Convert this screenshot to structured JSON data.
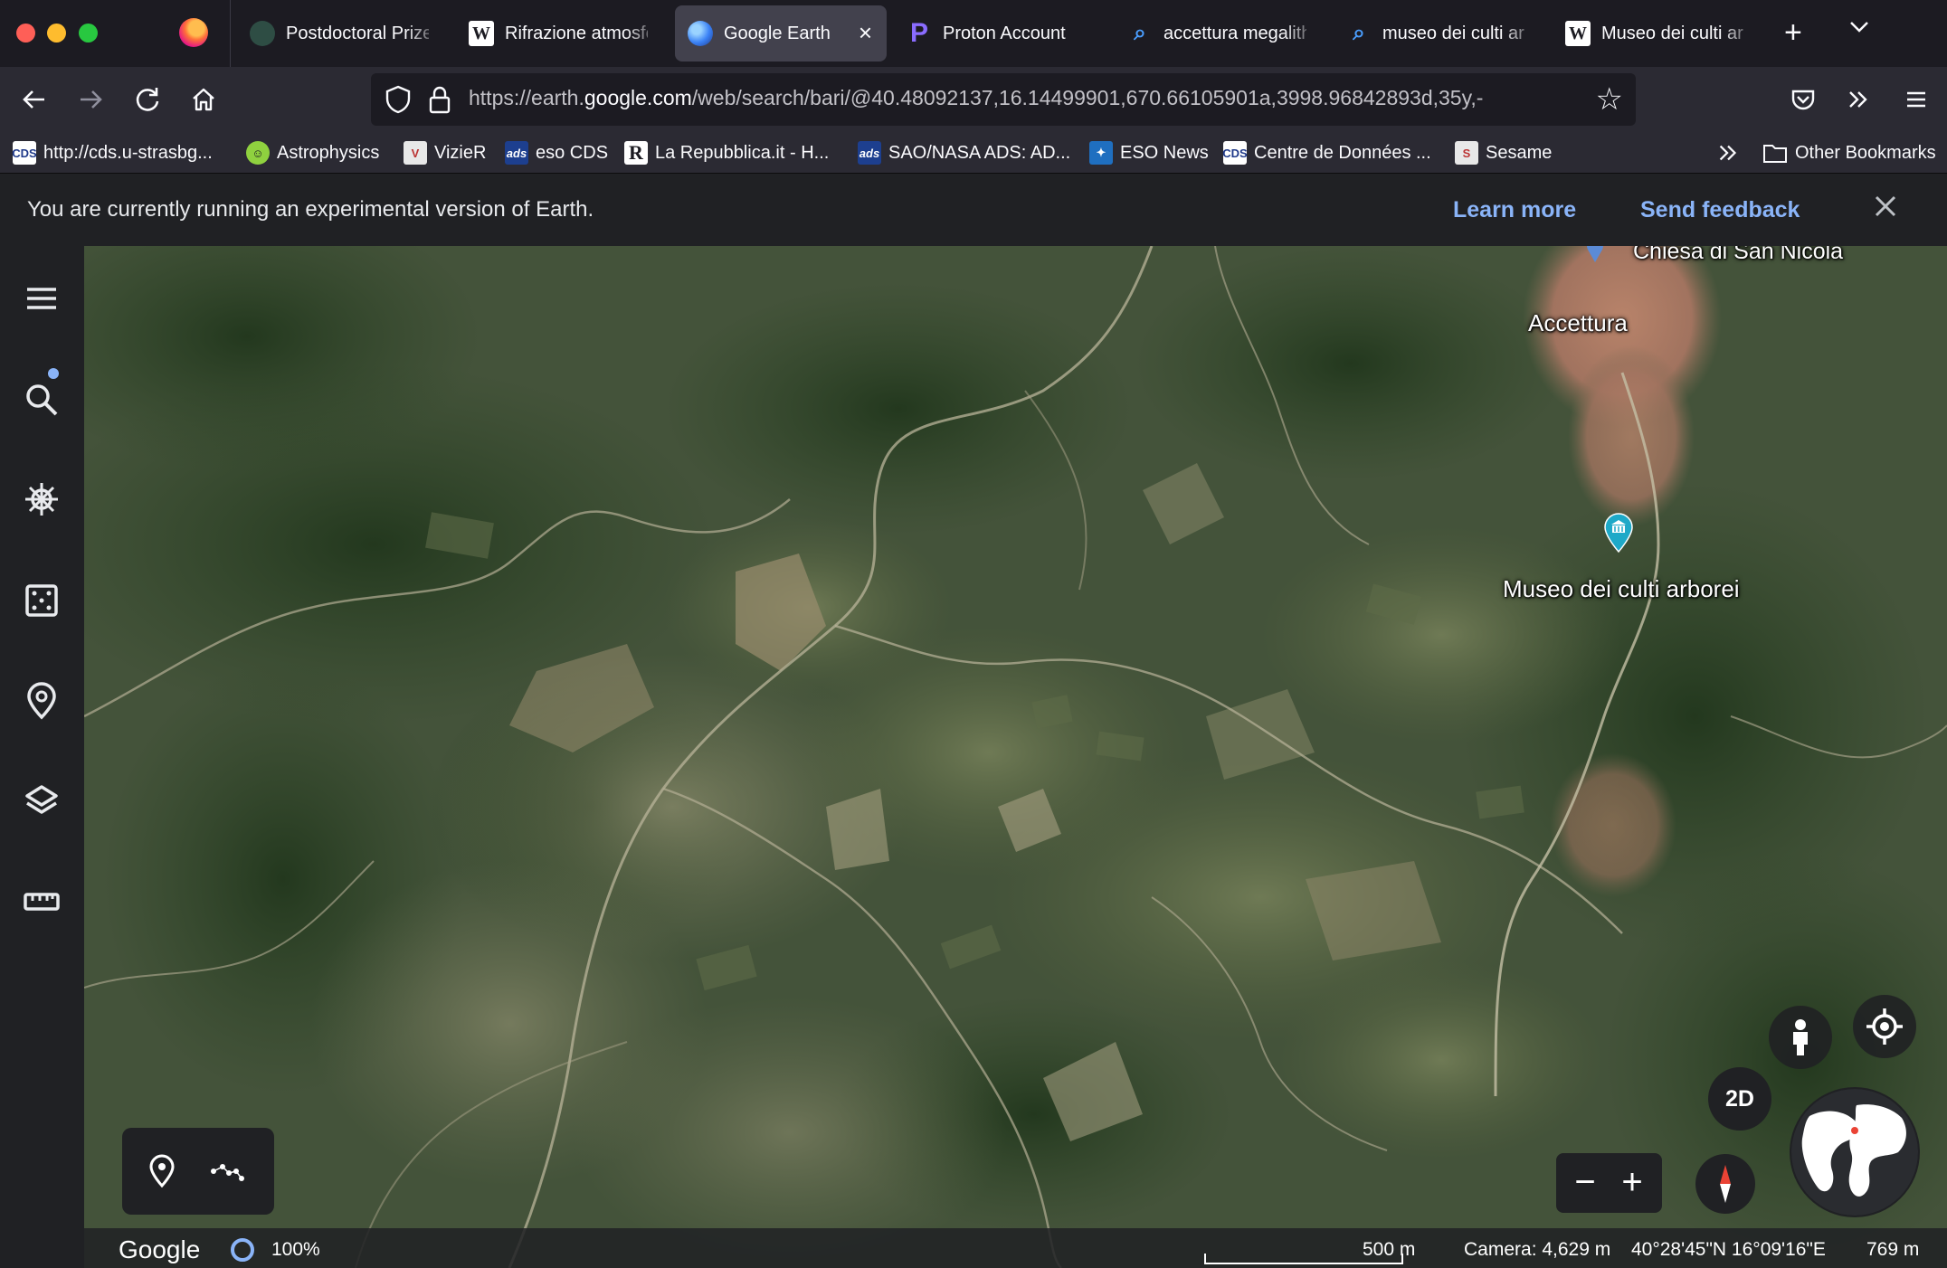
{
  "browser": {
    "tabs": [
      {
        "title": "Postdoctoral Prize",
        "favicon": "dark-globe-icon"
      },
      {
        "title": "Rifrazione atmosfe",
        "favicon": "wikipedia-w-icon"
      },
      {
        "title": "Google Earth",
        "favicon": "google-earth-icon",
        "active": true
      },
      {
        "title": "Proton Account",
        "favicon": "proton-icon"
      },
      {
        "title": "accettura megalith",
        "favicon": "search-icon"
      },
      {
        "title": "museo dei culti ar",
        "favicon": "search-icon"
      },
      {
        "title": "Museo dei culti ar",
        "favicon": "wikipedia-w-icon"
      }
    ],
    "url_prefix": "https://earth.",
    "url_host": "google.com",
    "url_rest": "/web/search/bari/@40.48092137,16.14499901,670.66105901a,3998.96842893d,35y,-",
    "bookmarks": [
      {
        "label": "http://cds.u-strasbg...",
        "icon": "cds-icon",
        "color": "#ffffff"
      },
      {
        "label": "Astrophysics",
        "icon": "smiley-icon",
        "color": "#8fd13f"
      },
      {
        "label": "VizieR",
        "icon": "vizier-icon",
        "color": "#e8e8e8"
      },
      {
        "label": "eso CDS",
        "icon": "ads-icon",
        "color": "#1d3f8f"
      },
      {
        "label": "La Repubblica.it - H...",
        "icon": "repubblica-icon",
        "color": "#ffffff"
      },
      {
        "label": "SAO/NASA ADS: AD...",
        "icon": "ads-icon",
        "color": "#1d3f8f"
      },
      {
        "label": "ESO News",
        "icon": "eso-icon",
        "color": "#1f6fc0"
      },
      {
        "label": "Centre de Données ...",
        "icon": "cds-icon",
        "color": "#ffffff"
      },
      {
        "label": "Sesame",
        "icon": "sesame-icon",
        "color": "#e8e8e8"
      }
    ],
    "other_bookmarks": "Other Bookmarks"
  },
  "banner": {
    "message": "You are currently running an experimental version of Earth.",
    "learn_more": "Learn more",
    "send_feedback": "Send feedback"
  },
  "map": {
    "labels": {
      "top": "Chiesa di San Nicola",
      "town": "Accettura",
      "poi": "Museo dei culti arborei"
    },
    "view_mode": "2D",
    "status": {
      "brand": "Google",
      "loading": "100%",
      "scale": "500 m",
      "camera": "Camera: 4,629 m",
      "coords": "40°28'45\"N 16°09'16\"E",
      "elevation": "769 m"
    }
  },
  "colors": {
    "accent": "#8ab4f8",
    "poi_pin": "#1ea9c8",
    "panel": "#202124"
  }
}
